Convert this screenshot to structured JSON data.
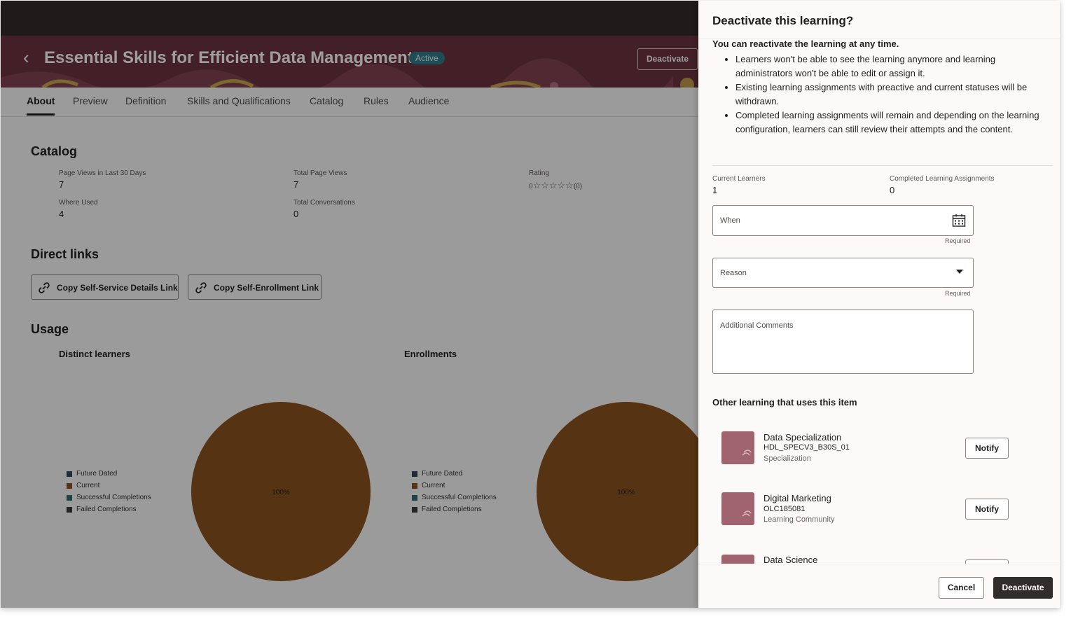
{
  "page": {
    "title": "Essential Skills for Efficient Data Management",
    "status": "Active",
    "deactivate_label": "Deactivate",
    "back_glyph": "‹"
  },
  "tabs": [
    {
      "label": "About",
      "active": true
    },
    {
      "label": "Preview"
    },
    {
      "label": "Definition"
    },
    {
      "label": "Skills and Qualifications"
    },
    {
      "label": "Catalog"
    },
    {
      "label": "Rules"
    },
    {
      "label": "Audience"
    }
  ],
  "catalog": {
    "title": "Catalog",
    "metrics": [
      {
        "label": "Page Views in Last 30 Days",
        "value": "7"
      },
      {
        "label": "Total Page Views",
        "value": "7"
      },
      {
        "label": "Where Used",
        "value": "4"
      },
      {
        "label": "Total Conversations",
        "value": "0"
      }
    ],
    "rating": {
      "label": "Rating",
      "value": "0",
      "stars": "☆☆☆☆☆",
      "count": "(0)"
    }
  },
  "direct_links": {
    "title": "Direct links",
    "buttons": [
      "Copy Self-Service Details Link",
      "Copy Self-Enrollment Link"
    ]
  },
  "usage": {
    "title": "Usage",
    "legend": [
      {
        "label": "Future Dated",
        "color": "#2a4a5e"
      },
      {
        "label": "Current",
        "color": "#8b5320"
      },
      {
        "label": "Successful Completions",
        "color": "#2e6f6a"
      },
      {
        "label": "Failed Completions",
        "color": "#3a3a3a"
      }
    ]
  },
  "chart_data": [
    {
      "type": "pie",
      "title": "Distinct learners",
      "slices": [
        {
          "label": "Current",
          "value": 100,
          "color": "#8b5320"
        }
      ],
      "data_labels": [
        "100%"
      ]
    },
    {
      "type": "pie",
      "title": "Enrollments",
      "slices": [
        {
          "label": "Current",
          "value": 100,
          "color": "#8b5320"
        }
      ],
      "data_labels": [
        "100%"
      ]
    }
  ],
  "drawer": {
    "title": "Deactivate this learning?",
    "lead": "You can reactivate the learning at any time.",
    "bullets": [
      "Learners won't be able to see the learning anymore and learning administrators won't be able to edit or assign it.",
      "Existing learning assignments with preactive and current statuses will be withdrawn.",
      "Completed learning assignments will remain and depending on the learning configuration, learners can still review their attempts and the content."
    ],
    "current_learners": {
      "label": "Current Learners",
      "value": "1"
    },
    "completed_assignments": {
      "label": "Completed Learning Assignments",
      "value": "0"
    },
    "when": {
      "label": "When",
      "hint": "Required"
    },
    "reason": {
      "label": "Reason",
      "hint": "Required"
    },
    "comments": {
      "label": "Additional Comments"
    },
    "other_title": "Other learning that uses this item",
    "items": [
      {
        "name": "Data Specialization",
        "code": "HDL_SPECV3_B30S_01",
        "type": "Specialization",
        "action": "Notify"
      },
      {
        "name": "Digital Marketing",
        "code": "OLC185081",
        "type": "Learning Community",
        "action": "Notify"
      },
      {
        "name": "Data Science"
      }
    ],
    "cancel_label": "Cancel",
    "confirm_label": "Deactivate"
  }
}
